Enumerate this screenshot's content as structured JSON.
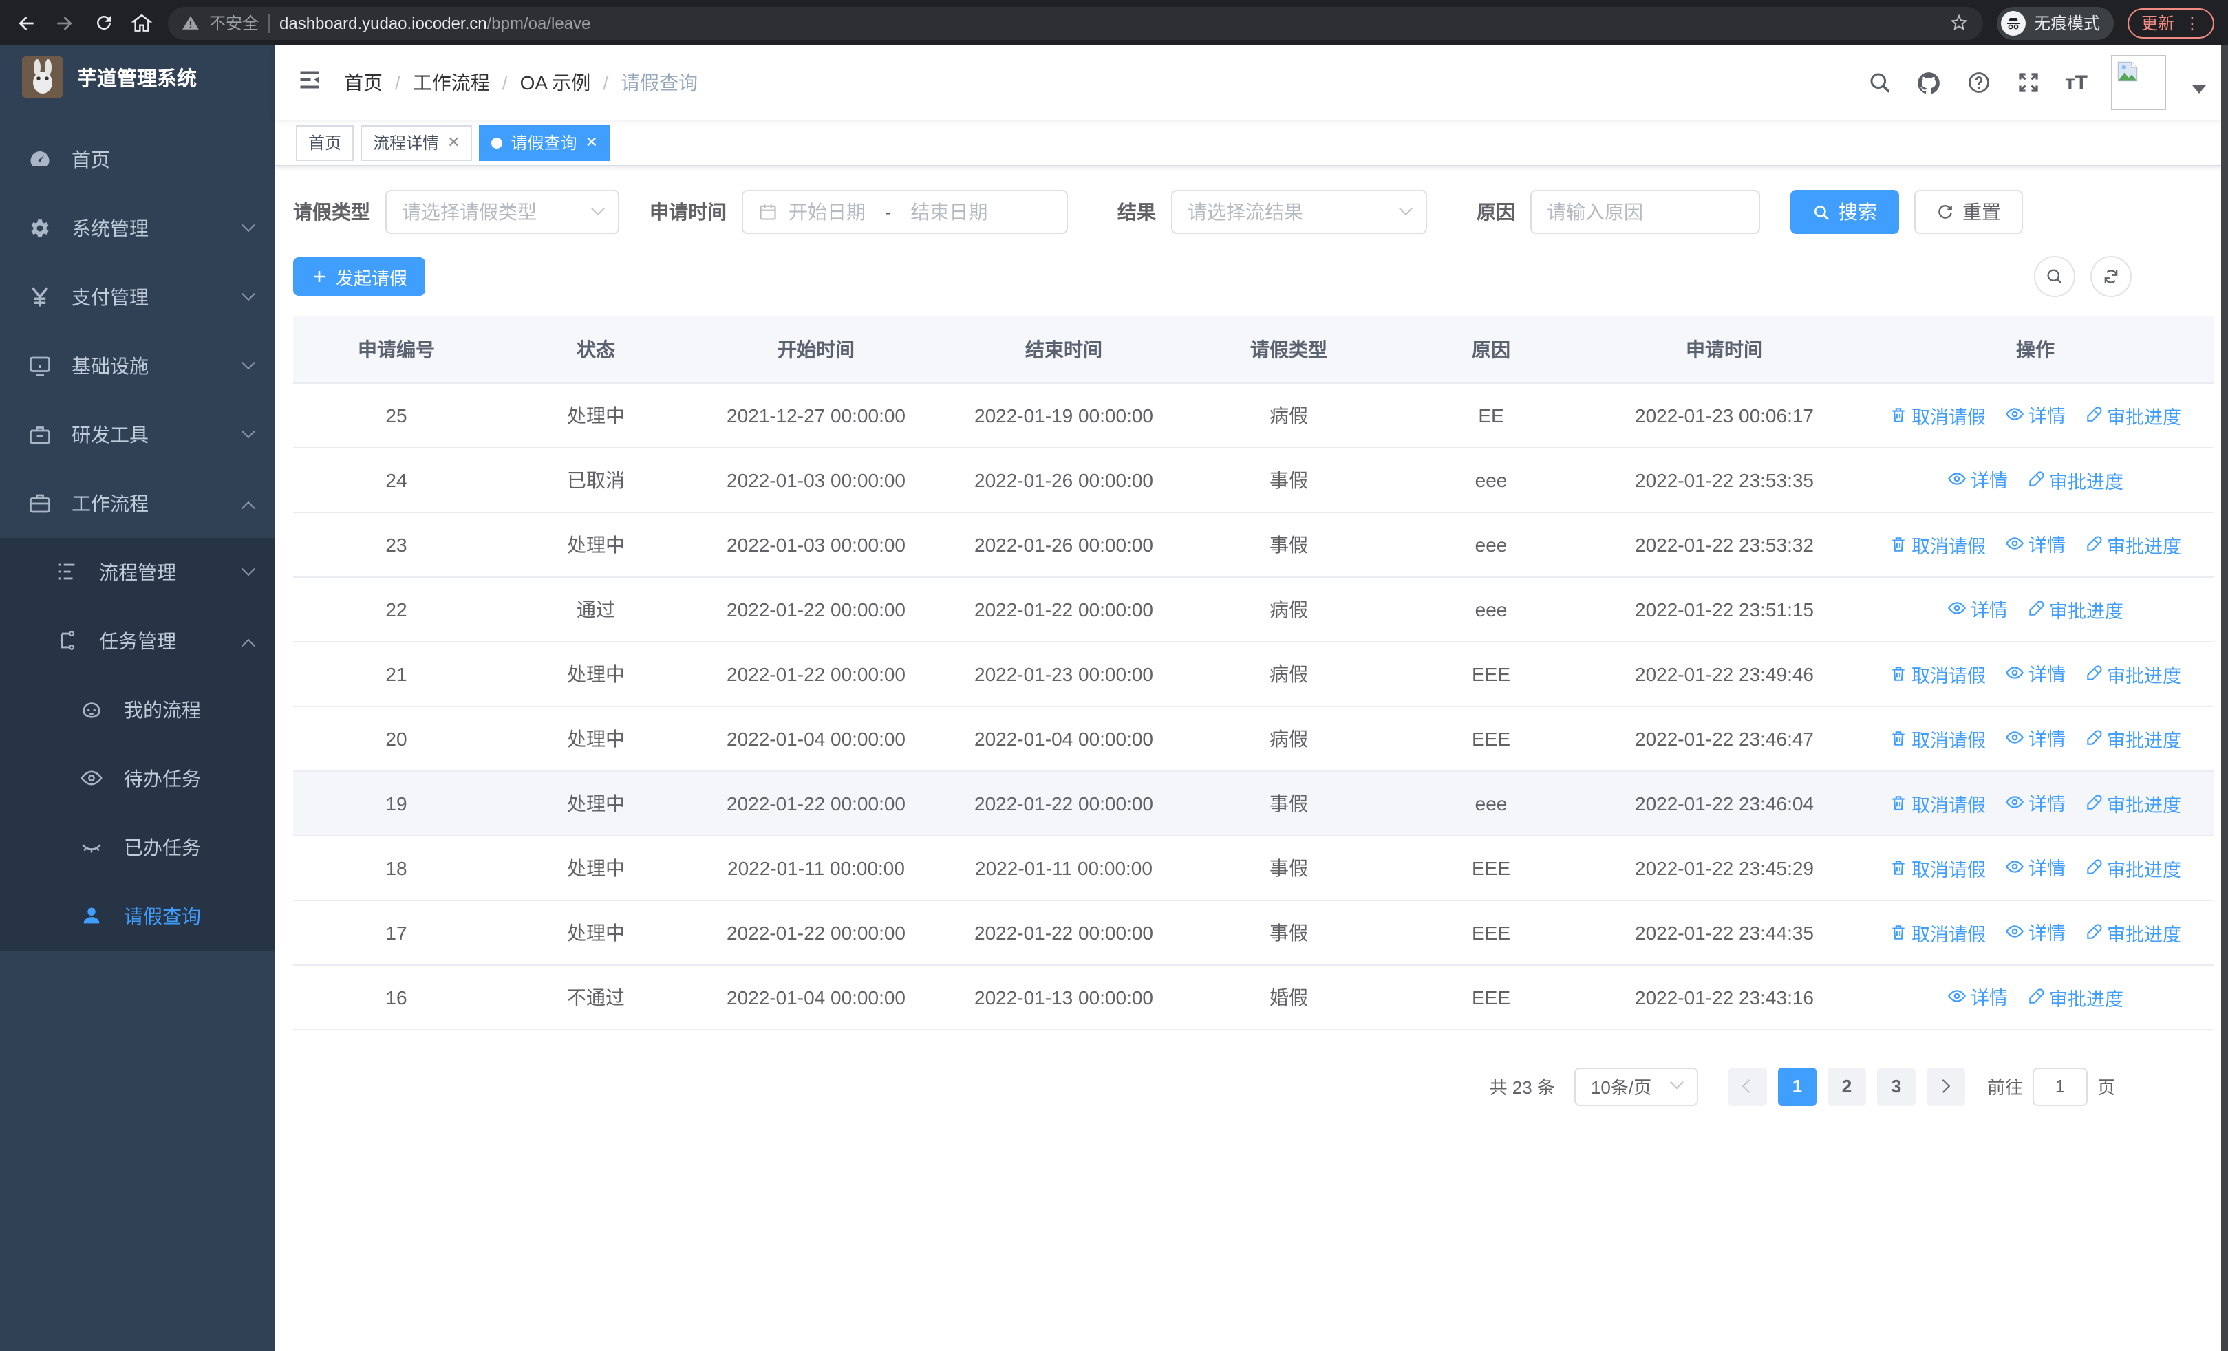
{
  "browser": {
    "security_label": "不安全",
    "url_host": "dashboard.yudao.iocoder.cn",
    "url_path": "/bpm/oa/leave",
    "incognito_label": "无痕模式",
    "update_label": "更新"
  },
  "sidebar": {
    "title": "芋道管理系统",
    "items": [
      {
        "label": "首页",
        "icon": "dashboard-icon"
      },
      {
        "label": "系统管理",
        "icon": "gear-icon"
      },
      {
        "label": "支付管理",
        "icon": "yen-icon"
      },
      {
        "label": "基础设施",
        "icon": "monitor-icon"
      },
      {
        "label": "研发工具",
        "icon": "toolbox-icon"
      },
      {
        "label": "工作流程",
        "icon": "briefcase-icon"
      }
    ],
    "submenu": [
      {
        "label": "流程管理",
        "icon": "list-tree-icon"
      },
      {
        "label": "任务管理",
        "icon": "flow-icon"
      },
      {
        "label": "我的流程",
        "icon": "face-icon"
      },
      {
        "label": "待办任务",
        "icon": "eye-icon"
      },
      {
        "label": "已办任务",
        "icon": "eye-closed-icon"
      },
      {
        "label": "请假查询",
        "icon": "user-icon"
      }
    ]
  },
  "navbar": {
    "breadcrumb": [
      "首页",
      "工作流程",
      "OA 示例",
      "请假查询"
    ]
  },
  "tags": {
    "home": "首页",
    "detail": "流程详情",
    "query": "请假查询"
  },
  "filters": {
    "leave_type_label": "请假类型",
    "leave_type_placeholder": "请选择请假类型",
    "apply_time_label": "申请时间",
    "date_start_placeholder": "开始日期",
    "date_separator": "-",
    "date_end_placeholder": "结束日期",
    "result_label": "结果",
    "result_placeholder": "请选择流结果",
    "reason_label": "原因",
    "reason_placeholder": "请输入原因",
    "search_label": "搜索",
    "reset_label": "重置"
  },
  "toolbar": {
    "create_label": "发起请假"
  },
  "table": {
    "columns": [
      "申请编号",
      "状态",
      "开始时间",
      "结束时间",
      "请假类型",
      "原因",
      "申请时间",
      "操作"
    ],
    "column_keys": [
      "id",
      "status",
      "start",
      "end",
      "type",
      "reason",
      "apply_time"
    ],
    "action_labels": {
      "cancel": "取消请假",
      "detail": "详情",
      "progress": "审批进度"
    },
    "rows": [
      {
        "id": "25",
        "status": "处理中",
        "start": "2021-12-27 00:00:00",
        "end": "2022-01-19 00:00:00",
        "type": "病假",
        "reason": "EE",
        "apply_time": "2022-01-23 00:06:17",
        "actions": [
          "cancel",
          "detail",
          "progress"
        ],
        "highlight": false
      },
      {
        "id": "24",
        "status": "已取消",
        "start": "2022-01-03 00:00:00",
        "end": "2022-01-26 00:00:00",
        "type": "事假",
        "reason": "eee",
        "apply_time": "2022-01-22 23:53:35",
        "actions": [
          "detail",
          "progress"
        ],
        "highlight": false
      },
      {
        "id": "23",
        "status": "处理中",
        "start": "2022-01-03 00:00:00",
        "end": "2022-01-26 00:00:00",
        "type": "事假",
        "reason": "eee",
        "apply_time": "2022-01-22 23:53:32",
        "actions": [
          "cancel",
          "detail",
          "progress"
        ],
        "highlight": false
      },
      {
        "id": "22",
        "status": "通过",
        "start": "2022-01-22 00:00:00",
        "end": "2022-01-22 00:00:00",
        "type": "病假",
        "reason": "eee",
        "apply_time": "2022-01-22 23:51:15",
        "actions": [
          "detail",
          "progress"
        ],
        "highlight": false
      },
      {
        "id": "21",
        "status": "处理中",
        "start": "2022-01-22 00:00:00",
        "end": "2022-01-23 00:00:00",
        "type": "病假",
        "reason": "EEE",
        "apply_time": "2022-01-22 23:49:46",
        "actions": [
          "cancel",
          "detail",
          "progress"
        ],
        "highlight": false
      },
      {
        "id": "20",
        "status": "处理中",
        "start": "2022-01-04 00:00:00",
        "end": "2022-01-04 00:00:00",
        "type": "病假",
        "reason": "EEE",
        "apply_time": "2022-01-22 23:46:47",
        "actions": [
          "cancel",
          "detail",
          "progress"
        ],
        "highlight": false
      },
      {
        "id": "19",
        "status": "处理中",
        "start": "2022-01-22 00:00:00",
        "end": "2022-01-22 00:00:00",
        "type": "事假",
        "reason": "eee",
        "apply_time": "2022-01-22 23:46:04",
        "actions": [
          "cancel",
          "detail",
          "progress"
        ],
        "highlight": true
      },
      {
        "id": "18",
        "status": "处理中",
        "start": "2022-01-11 00:00:00",
        "end": "2022-01-11 00:00:00",
        "type": "事假",
        "reason": "EEE",
        "apply_time": "2022-01-22 23:45:29",
        "actions": [
          "cancel",
          "detail",
          "progress"
        ],
        "highlight": false
      },
      {
        "id": "17",
        "status": "处理中",
        "start": "2022-01-22 00:00:00",
        "end": "2022-01-22 00:00:00",
        "type": "事假",
        "reason": "EEE",
        "apply_time": "2022-01-22 23:44:35",
        "actions": [
          "cancel",
          "detail",
          "progress"
        ],
        "highlight": false
      },
      {
        "id": "16",
        "status": "不通过",
        "start": "2022-01-04 00:00:00",
        "end": "2022-01-13 00:00:00",
        "type": "婚假",
        "reason": "EEE",
        "apply_time": "2022-01-22 23:43:16",
        "actions": [
          "detail",
          "progress"
        ],
        "highlight": false
      }
    ]
  },
  "pagination": {
    "total_label": "共 23 条",
    "page_size": "10条/页",
    "pages": [
      "1",
      "2",
      "3"
    ],
    "active_page": "1",
    "goto_label": "前往",
    "goto_value": "1",
    "goto_suffix": "页"
  },
  "colors": {
    "primary": "#409eff",
    "sidebar": "#304156",
    "submenu": "#263445"
  }
}
